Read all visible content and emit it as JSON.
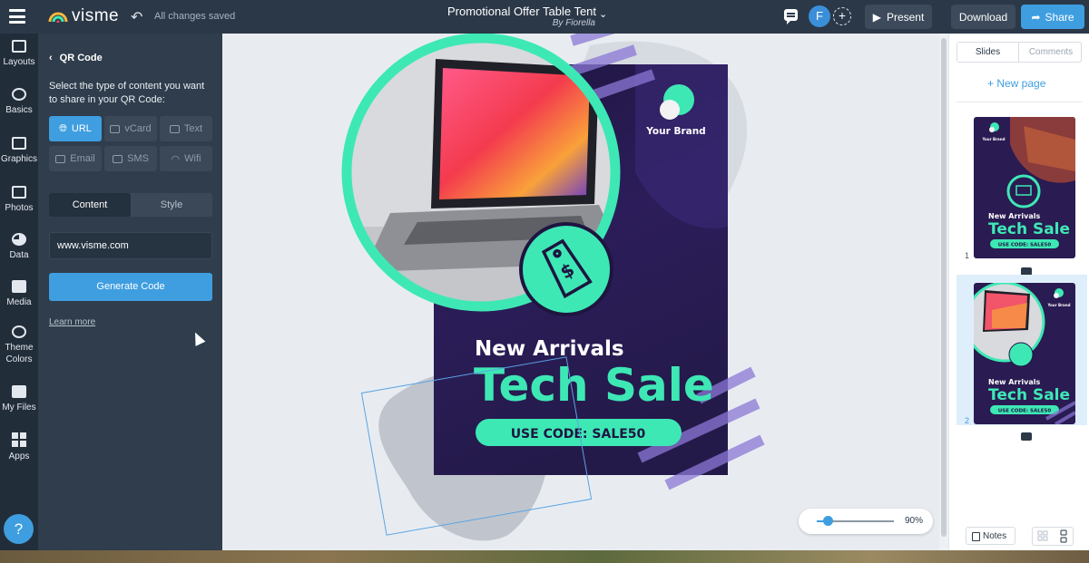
{
  "header": {
    "logo_text": "visme",
    "save_status": "All changes saved",
    "doc_title": "Promotional Offer Table Tent",
    "doc_author": "By Fiorella",
    "avatar_initial": "F",
    "present_label": "Present",
    "download_label": "Download",
    "share_label": "Share"
  },
  "rail": {
    "items": [
      {
        "label": "Layouts",
        "icon": "layouts-icon"
      },
      {
        "label": "Basics",
        "icon": "basics-icon"
      },
      {
        "label": "Graphics",
        "icon": "graphics-icon"
      },
      {
        "label": "Photos",
        "icon": "photos-icon"
      },
      {
        "label": "Data",
        "icon": "data-icon"
      },
      {
        "label": "Media",
        "icon": "media-icon"
      },
      {
        "label": "Theme Colors",
        "icon": "palette-icon"
      },
      {
        "label": "My Files",
        "icon": "folder-icon"
      },
      {
        "label": "Apps",
        "icon": "apps-icon"
      }
    ],
    "help_label": "?"
  },
  "qr_panel": {
    "title": "QR Code",
    "description": "Select the type of content you want to share in your QR Code:",
    "types": [
      {
        "label": "URL",
        "active": true
      },
      {
        "label": "vCard",
        "active": false
      },
      {
        "label": "Text",
        "active": false
      },
      {
        "label": "Email",
        "active": false
      },
      {
        "label": "SMS",
        "active": false
      },
      {
        "label": "Wifi",
        "active": false
      }
    ],
    "tabs": [
      {
        "label": "Content",
        "active": true
      },
      {
        "label": "Style",
        "active": false
      }
    ],
    "url_value": "www.visme.com",
    "generate_label": "Generate Code",
    "learn_more_label": "Learn more"
  },
  "poster": {
    "brand_label": "Your Brand",
    "headline": "New Arrivals",
    "title": "Tech Sale",
    "code_label": "USE CODE: SALE50"
  },
  "zoom": {
    "value_label": "90%",
    "level": 0.9
  },
  "right_panel": {
    "tabs": [
      {
        "label": "Slides",
        "active": true
      },
      {
        "label": "Comments",
        "active": false
      }
    ],
    "new_page_label": "+ New page",
    "slides": [
      {
        "number": "1",
        "headline": "New Arrivals",
        "title": "Tech Sale",
        "code": "USE CODE: SALE50",
        "brand": "Your Brand"
      },
      {
        "number": "2",
        "headline": "New Arrivals",
        "title": "Tech Sale",
        "code": "USE CODE: SALE50",
        "brand": "Your Brand"
      }
    ],
    "notes_label": "Notes"
  },
  "colors": {
    "accent": "#3e9ee0",
    "dark_bg": "#2b3848",
    "poster_teal": "#3ee8b5",
    "poster_purple": "#2a1b52"
  }
}
